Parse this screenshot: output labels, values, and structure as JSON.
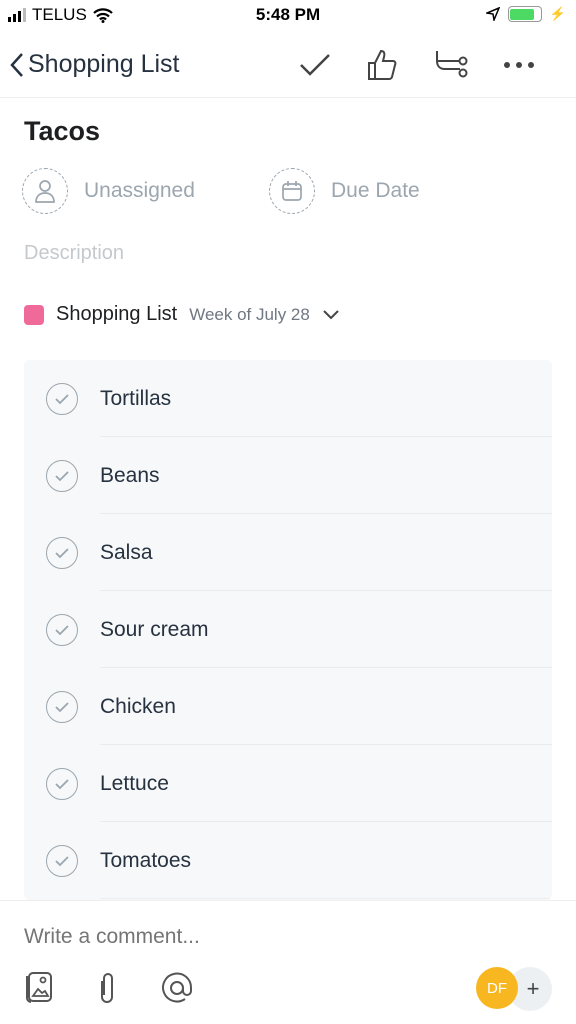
{
  "status": {
    "carrier": "TELUS",
    "time": "5:48 PM"
  },
  "nav": {
    "back_label": "Shopping List"
  },
  "task": {
    "title": "Tacos",
    "assignee": "Unassigned",
    "due_date": "Due Date",
    "description_placeholder": "Description"
  },
  "project": {
    "name": "Shopping List",
    "color": "#f06a99",
    "section": "Week of July 28"
  },
  "subtasks": [
    "Tortillas",
    "Beans",
    "Salsa",
    "Sour cream",
    "Chicken",
    "Lettuce",
    "Tomatoes"
  ],
  "comment": {
    "placeholder": "Write a comment..."
  },
  "collaborators": {
    "initials": "DF",
    "add": "+"
  }
}
